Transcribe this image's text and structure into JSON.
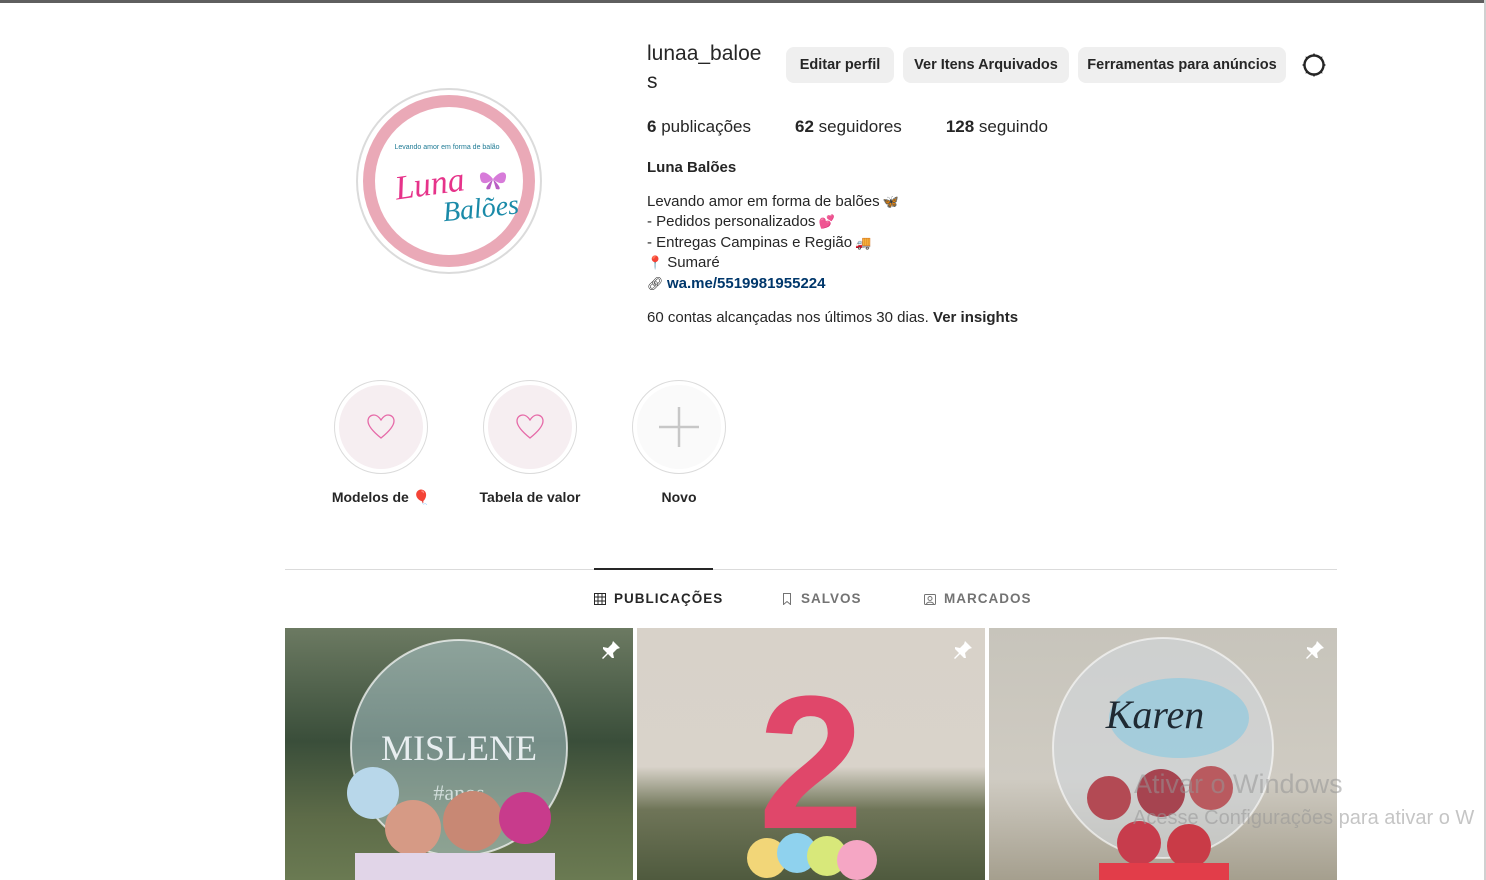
{
  "profile": {
    "username": "lunaa_baloes",
    "full_name": "Luna Balões",
    "avatar_text_top": "Levando amor em forma de balão",
    "avatar_text_1": "Luna",
    "avatar_text_2": "Balões"
  },
  "actions": {
    "edit_profile": "Editar perfil",
    "archived": "Ver Itens Arquivados",
    "ad_tools": "Ferramentas para anúncios"
  },
  "stats": {
    "posts_count": "6",
    "posts_label": "publicações",
    "followers_count": "62",
    "followers_label": "seguidores",
    "following_count": "128",
    "following_label": "seguindo"
  },
  "bio": {
    "line1": "Levando amor em forma de balões",
    "line1_emoji": "🦋",
    "line2": "- Pedidos personalizados",
    "line2_emoji": "💕",
    "line3": "- Entregas Campinas e Região",
    "line3_emoji": "🚚",
    "line4_emoji": "📍",
    "line4": "Sumaré",
    "link": "wa.me/5519981955224"
  },
  "insights": {
    "text": "60 contas alcançadas nos últimos 30 dias.",
    "link": "Ver insights"
  },
  "highlights": [
    {
      "label": "Modelos de 🎈"
    },
    {
      "label": "Tabela de valor"
    },
    {
      "label": "Novo"
    }
  ],
  "tabs": {
    "posts": "PUBLICAÇÕES",
    "saved": "SALVOS",
    "tagged": "MARCADOS"
  },
  "posts": [
    {
      "overlay_text": "MISLENE",
      "overlay_sub": "#anos"
    },
    {
      "overlay_text": "2"
    },
    {
      "overlay_text": "Karen"
    }
  ],
  "watermark": {
    "line1": "Ativar o Windows",
    "line2": "Acesse Configurações para ativar o W"
  },
  "colors": {
    "accent_link": "#00376b",
    "button_bg": "#efefef",
    "avatar_ring": "#eaa9b7",
    "text": "#262626",
    "muted": "#737373"
  }
}
